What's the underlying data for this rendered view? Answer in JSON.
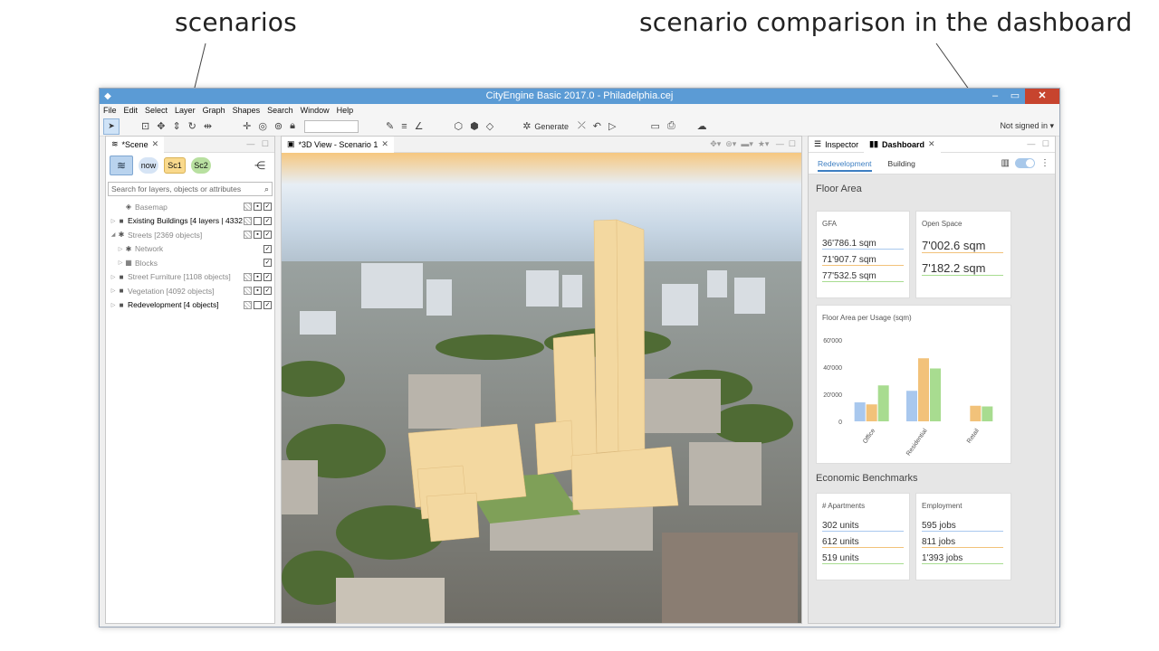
{
  "annotations": {
    "scenarios": "scenarios",
    "comparison": "scenario comparison in the dashboard"
  },
  "window": {
    "title": "CityEngine Basic 2017.0 - Philadelphia.cej",
    "minimize": "–",
    "maximize": "▭",
    "close": "✕"
  },
  "menu": [
    "File",
    "Edit",
    "Select",
    "Layer",
    "Graph",
    "Shapes",
    "Search",
    "Window",
    "Help"
  ],
  "toolbar": {
    "generate_label": "Generate",
    "signed_in": "Not signed in ▾"
  },
  "scene": {
    "tab_label": "*Scene",
    "scenarios": [
      "now",
      "Sc1",
      "Sc2"
    ],
    "search_placeholder": "Search for layers, objects or attributes",
    "layers": [
      {
        "name": "Basemap",
        "dim": true
      },
      {
        "name": "Existing Buildings [4 layers | 4332",
        "dim": false
      },
      {
        "name": "Streets [2369 objects]",
        "dim": true
      },
      {
        "name": "Network",
        "dim": true
      },
      {
        "name": "Blocks",
        "dim": true
      },
      {
        "name": "Street Furniture [1108 objects]",
        "dim": true
      },
      {
        "name": "Vegetation [4092 objects]",
        "dim": true
      },
      {
        "name": "Redevelopment [4 objects]",
        "dim": false
      }
    ]
  },
  "view": {
    "tab_label": "*3D View - Scenario 1"
  },
  "dashboard": {
    "tabs": [
      "Inspector",
      "Dashboard"
    ],
    "subtabs": [
      "Redevelopment",
      "Building"
    ],
    "floor_area_title": "Floor Area",
    "gfa": {
      "title": "GFA",
      "values": [
        "36'786.1 sqm",
        "71'907.7 sqm",
        "77'532.5 sqm"
      ]
    },
    "open_space": {
      "title": "Open Space",
      "values": [
        "7'002.6 sqm",
        "7'182.2 sqm"
      ]
    },
    "economic_title": "Economic Benchmarks",
    "apartments": {
      "title": "# Apartments",
      "values": [
        "302 units",
        "612 units",
        "519 units"
      ]
    },
    "employment": {
      "title": "Employment",
      "values": [
        "595 jobs",
        "811 jobs",
        "1'393 jobs"
      ]
    }
  },
  "colors": {
    "now": "#a9c8ee",
    "sc1": "#f2c27a",
    "sc2": "#a8dc90"
  },
  "chart_data": {
    "type": "bar",
    "title": "Floor Area per Usage (sqm)",
    "categories": [
      "Office",
      "Residential",
      "Retail"
    ],
    "series": [
      {
        "values": [
          14000,
          22500,
          0
        ]
      },
      {
        "values": [
          12500,
          46500,
          11500
        ]
      },
      {
        "values": [
          26500,
          39000,
          11000
        ]
      }
    ],
    "yticks": [
      "0",
      "20'000",
      "40'000",
      "60'000"
    ],
    "ylim": [
      0,
      60000
    ]
  }
}
